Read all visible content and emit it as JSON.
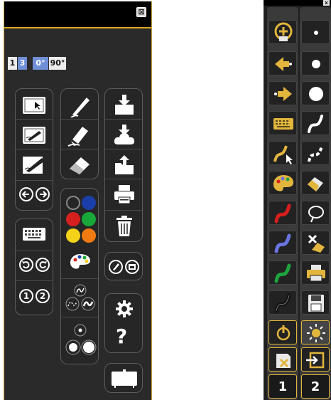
{
  "left_panel": {
    "close_glyph": "⊠",
    "page_toggle": [
      "1",
      "3"
    ],
    "rotation_toggle": [
      "0°",
      "90°"
    ],
    "palette_colors": [
      "#2a2a2a",
      "#1a3fa8",
      "#d62020",
      "#18a83a",
      "#f4d21a",
      "#f07b12"
    ],
    "page_numbers": [
      "1",
      "2"
    ]
  },
  "right_panel": {
    "close_glyph": "x",
    "page_buttons": [
      "1",
      "2"
    ],
    "ink_colors": [
      "#e2b53c",
      "#d61f1f",
      "#6a74e0",
      "#1ea23f",
      "#ffffff"
    ]
  }
}
